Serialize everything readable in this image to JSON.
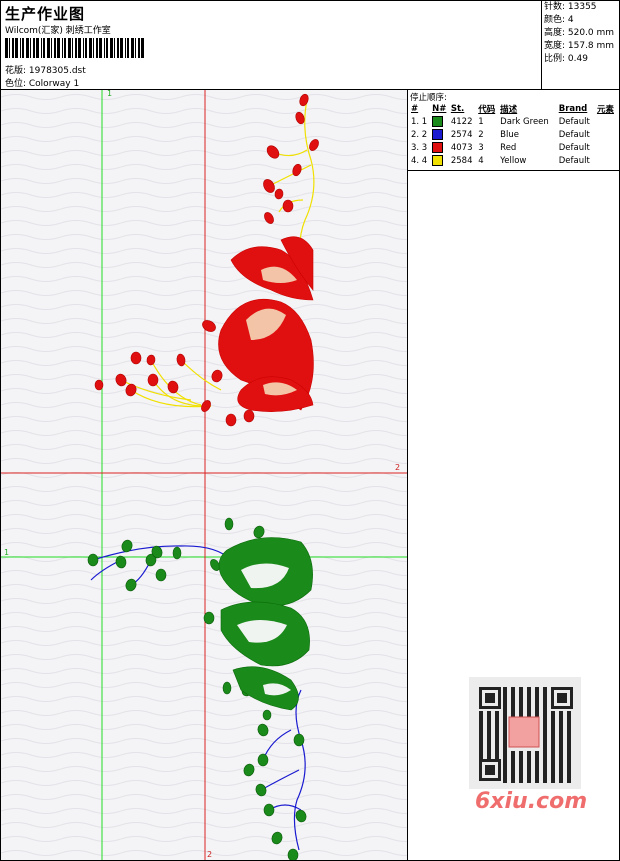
{
  "header": {
    "title": "生产作业图",
    "company": "Wilcom(汇家) 刺绣工作室",
    "design_label": "花版: 1978305.dst",
    "colorway_label": "色位:  Colorway 1"
  },
  "stats": {
    "stitches": "针数:  13355",
    "colors": "颜色:  4",
    "height": "高度:  520.0 mm",
    "width": "宽度:  157.8 mm",
    "scale": "比例:  0.49"
  },
  "legend": {
    "title": "停止顺序:",
    "headers": [
      "#",
      "N#",
      "St.",
      "代码",
      "描述",
      "Brand",
      "元素"
    ],
    "rows": [
      {
        "idx": "1. 1",
        "color": "#1a8a1a",
        "st": "4122",
        "code": "1",
        "desc": "Dark Green",
        "brand": "Default"
      },
      {
        "idx": "2. 2",
        "color": "#1a1ad0",
        "st": "2574",
        "code": "2",
        "desc": "Blue",
        "brand": "Default"
      },
      {
        "idx": "3. 3",
        "color": "#e01010",
        "st": "4073",
        "code": "3",
        "desc": "Red",
        "brand": "Default"
      },
      {
        "idx": "4. 4",
        "color": "#f0e000",
        "st": "2584",
        "code": "4",
        "desc": "Yellow",
        "brand": "Default"
      }
    ]
  },
  "canvas": {
    "axis_labels": {
      "v_green": "1",
      "h_red": "2",
      "h_green": "1",
      "v_red": "2"
    }
  },
  "watermark": "6xiu.com",
  "colors": {
    "dark_green": "#1a8a1a",
    "blue": "#1a1ad0",
    "red": "#e01010",
    "yellow": "#f0e000",
    "guide_green": "#22dd22",
    "guide_red": "#dd2222"
  }
}
